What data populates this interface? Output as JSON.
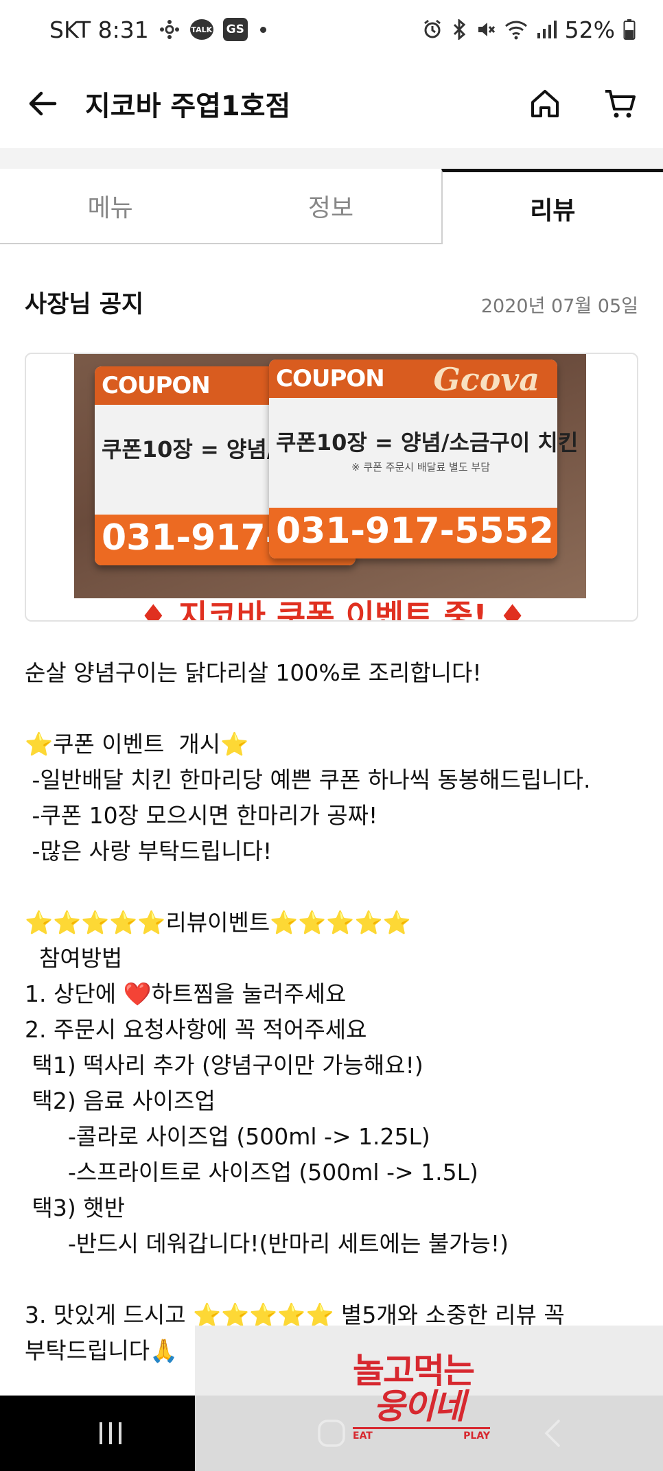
{
  "status_bar": {
    "carrier_time": "SKT 8:31",
    "talk_badge": "TALK",
    "gs_badge": "GS",
    "battery": "52%",
    "icons": [
      "network-icon",
      "kakaotalk-icon",
      "gs-icon",
      "alarm-icon",
      "bluetooth-icon",
      "mute-icon",
      "wifi-icon",
      "signal-icon",
      "battery-icon"
    ]
  },
  "header": {
    "title": "지코바 주엽1호점",
    "icons": [
      "back-arrow-icon",
      "home-icon",
      "cart-icon"
    ]
  },
  "tabs": [
    {
      "label": "메뉴",
      "active": false
    },
    {
      "label": "정보",
      "active": false
    },
    {
      "label": "리뷰",
      "active": true
    }
  ],
  "notice": {
    "title": "사장님 공지",
    "date": "2020년 07월 05일",
    "image": {
      "coupon_word": "COUPON",
      "brand": "Gcova",
      "card_text": "쿠폰10장 = 양념/소금구이 치킨",
      "card_small": "※ 쿠폰 주문시 배달료 별도 부담",
      "phone": "031-917-5552",
      "caption": "♦ 지코바 쿠폰 이벤트 중! ♦"
    },
    "lines": [
      "순살 양념구이는 닭다리살 100%로 조리합니다!",
      "",
      "⭐쿠폰 이벤트  개시⭐",
      " -일반배달 치킨 한마리당 예쁜 쿠폰 하나씩 동봉해드립니다.",
      " -쿠폰 10장 모으시면 한마리가 공짜!",
      " -많은 사랑 부탁드립니다!",
      "",
      "⭐⭐⭐⭐⭐리뷰이벤트⭐⭐⭐⭐⭐",
      "  참여방법",
      "1. 상단에 ❤️하트찜을 눌러주세요",
      "2. 주문시 요청사항에 꼭 적어주세요",
      " 택1) 떡사리 추가 (양념구이만 가능해요!)",
      " 택2) 음료 사이즈업",
      "      -콜라로 사이즈업 (500ml -> 1.25L)",
      "      -스프라이트로 사이즈업 (500ml -> 1.5L)",
      " 택3) 햇반",
      "      -반드시 데워갑니다!(반마리 세트에는 불가능!)",
      "",
      "3. 맛있게 드시고 ⭐⭐⭐⭐⭐ 별5개와 소중한 리뷰 꼭",
      "부탁드립니다🙏"
    ]
  },
  "nav_bar": {
    "buttons": [
      "recent-apps-icon",
      "home-circle-icon",
      "back-chevron-icon"
    ]
  },
  "watermark": {
    "line1": "놀고먹는",
    "line2": "웅이네",
    "left": "EAT",
    "right": "PLAY"
  }
}
